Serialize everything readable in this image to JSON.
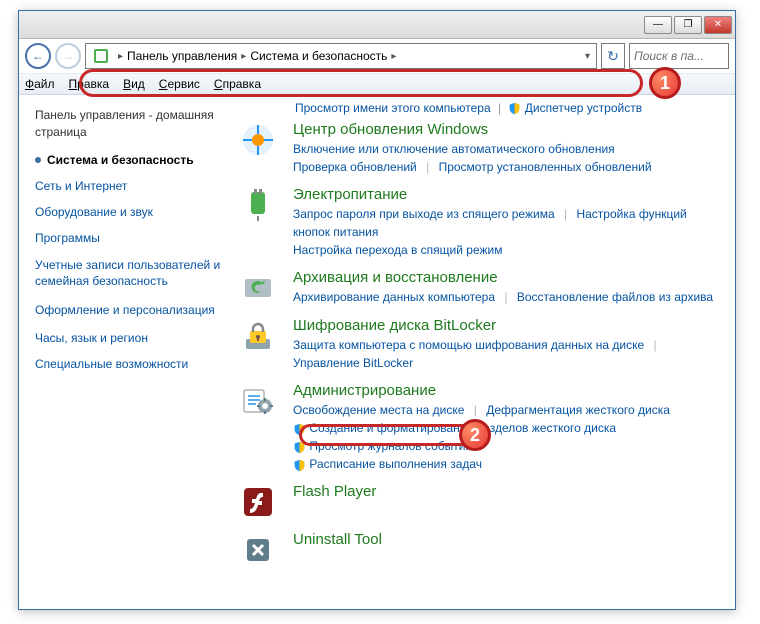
{
  "window": {
    "minimize": "—",
    "maximize": "❐",
    "close": "✕"
  },
  "addr": {
    "bc1": "Панель управления",
    "bc2": "Система и безопасность",
    "sep": "▸",
    "drop": "▾",
    "badge1": "1",
    "refresh": "↻"
  },
  "search": {
    "placeholder": "Поиск в па..."
  },
  "menu": {
    "file": "Файл",
    "edit": "Правка",
    "view": "Вид",
    "tools": "Сервис",
    "help": "Справка"
  },
  "sidebar": {
    "home": "Панель управления - домашняя страница",
    "active": "Система и безопасность",
    "links": [
      "Сеть и Интернет",
      "Оборудование и звук",
      "Программы",
      "Учетные записи пользователей и семейная безопасность",
      "Оформление и персонализация",
      "Часы, язык и регион",
      "Специальные возможности"
    ]
  },
  "topline": {
    "a": "Просмотр имени этого компьютера",
    "b": "Диспетчер устройств"
  },
  "cats": {
    "update": {
      "title": "Центр обновления Windows",
      "l1": "Включение или отключение автоматического обновления",
      "l2": "Проверка обновлений",
      "l3": "Просмотр установленных обновлений"
    },
    "power": {
      "title": "Электропитание",
      "l1": "Запрос пароля при выходе из спящего режима",
      "l2": "Настройка функций кнопок питания",
      "l3": "Настройка перехода в спящий режим"
    },
    "backup": {
      "title": "Архивация и восстановление",
      "l1": "Архивирование данных компьютера",
      "l2": "Восстановление файлов из архива"
    },
    "bitlocker": {
      "title": "Шифрование диска BitLocker",
      "l1": "Защита компьютера с помощью шифрования данных на диске",
      "l2": "Управление BitLocker"
    },
    "admin": {
      "title": "Администрирование",
      "badge": "2",
      "l1": "Освобождение места на диске",
      "l2": "Дефрагментация жесткого диска",
      "l3": "Создание и форматирование разделов жесткого диска",
      "l4": "Просмотр журналов событий",
      "l5": "Расписание выполнения задач"
    },
    "flash": {
      "title": "Flash Player"
    },
    "uninstall": {
      "title": "Uninstall Tool"
    }
  }
}
